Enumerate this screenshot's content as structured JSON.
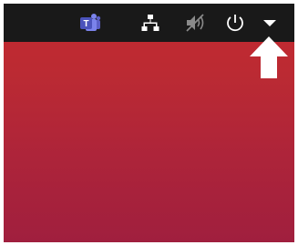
{
  "topbar": {
    "icons": [
      {
        "name": "teams-icon"
      },
      {
        "name": "network-icon"
      },
      {
        "name": "volume-muted-icon"
      },
      {
        "name": "power-icon"
      },
      {
        "name": "system-menu-arrow-icon"
      }
    ]
  },
  "annotation": {
    "name": "white-arrow-pointer"
  },
  "colors": {
    "topbar_bg": "#191919",
    "desktop_top": "#c42b2f",
    "desktop_bottom": "#a01f3e",
    "icon_white": "#ffffff",
    "teams_purple": "#5b5fc7"
  }
}
